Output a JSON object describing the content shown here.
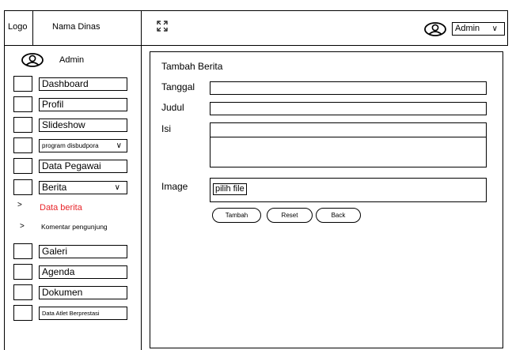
{
  "header": {
    "logo": "Logo",
    "agency_name": "Nama Dinas",
    "user_select": "Admin"
  },
  "sidebar": {
    "user_name": "Admin",
    "items": [
      {
        "label": "Dashboard"
      },
      {
        "label": "Profil"
      },
      {
        "label": "Slideshow"
      },
      {
        "label": "program disbudpora"
      },
      {
        "label": "Data Pegawai"
      },
      {
        "label": "Berita"
      },
      {
        "label": "Galeri"
      },
      {
        "label": "Agenda"
      },
      {
        "label": "Dokumen"
      },
      {
        "label": "Data Atlet Berprestasi"
      }
    ],
    "sub_items": [
      {
        "label": "Data berita",
        "active": true,
        "color": "#e8262b"
      },
      {
        "label": "Komentar pengunjung",
        "active": false
      }
    ],
    "sub_marker": ">"
  },
  "form": {
    "title": "Tambah Berita",
    "fields": {
      "tanggal": {
        "label": "Tanggal",
        "value": ""
      },
      "judul": {
        "label": "Judul",
        "value": ""
      },
      "isi": {
        "label": "Isi",
        "value": ""
      },
      "image": {
        "label": "Image",
        "button": "pilih file"
      }
    },
    "buttons": {
      "tambah": "Tambah",
      "reset": "Reset",
      "back": "Back"
    }
  }
}
